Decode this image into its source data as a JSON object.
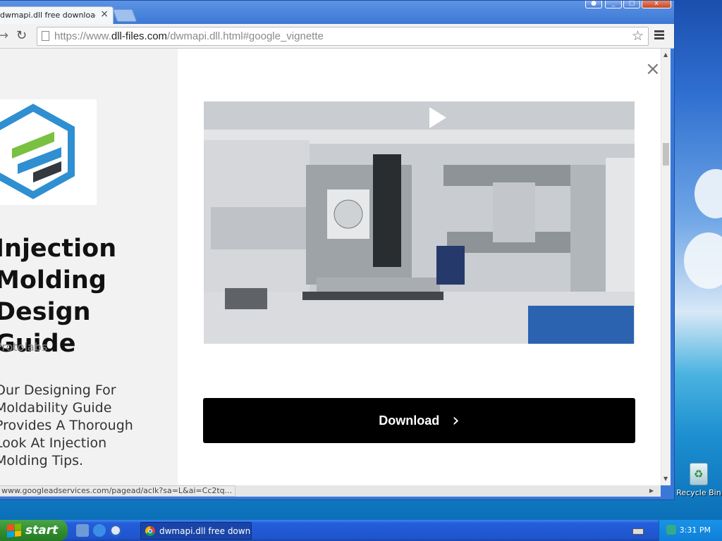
{
  "browser": {
    "tab_title": "dwmapi.dll free download | DLL-files.com",
    "tab_close": "×",
    "url_prefix": "https://www.",
    "url_host": "dll-files.com",
    "url_rest": "/dwmapi.dll.html#google_vignette",
    "status_url": "www.googleadservices.com/pagead/aclk?sa=L&ai=Cc2tq..."
  },
  "ad": {
    "title": "Injection\nMolding\nDesign Guide",
    "advertiser": "Protolabs",
    "description": "Our Designing For\nMoldability Guide\nProvides A Thorough\nLook At Injection\nMolding Tips.",
    "close_label": "×",
    "download_label": "Download",
    "download_chevron": "›"
  },
  "desktop": {
    "recycle_label": "Recycle Bin"
  },
  "taskbar": {
    "start_label": "start",
    "task_label": "dwmapi.dll free downl...",
    "clock": "3:31 PM"
  },
  "colors": {
    "logo_blue": "#2f8fd1",
    "logo_green": "#7ac142",
    "logo_dark": "#33393f",
    "download_bg": "#000000"
  }
}
